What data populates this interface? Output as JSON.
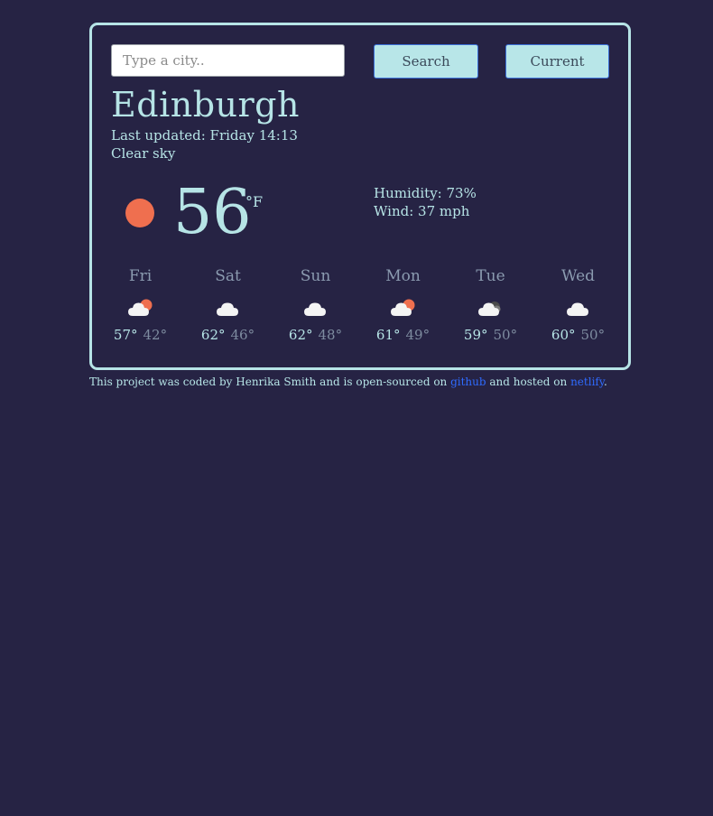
{
  "search": {
    "placeholder": "Type a city..",
    "search_label": "Search",
    "current_label": "Current"
  },
  "weather": {
    "city": "Edinburgh",
    "last_updated": "Last updated: Friday 14:13",
    "description": "Clear sky",
    "temperature": "56",
    "unit": "°F",
    "humidity": "Humidity: 73%",
    "wind": "Wind: 37 mph",
    "icon": "sun-icon"
  },
  "forecast": [
    {
      "day": "Fri",
      "max": "57°",
      "min": "42°",
      "icon": "cloud-sun-icon"
    },
    {
      "day": "Sat",
      "max": "62°",
      "min": "46°",
      "icon": "cloud-icon"
    },
    {
      "day": "Sun",
      "max": "62°",
      "min": "48°",
      "icon": "cloud-icon"
    },
    {
      "day": "Mon",
      "max": "61°",
      "min": "49°",
      "icon": "cloud-sun-icon"
    },
    {
      "day": "Tue",
      "max": "59°",
      "min": "50°",
      "icon": "cloud-moon-icon"
    },
    {
      "day": "Wed",
      "max": "60°",
      "min": "50°",
      "icon": "cloud-icon"
    }
  ],
  "footer": {
    "text_1": "This project was coded by Henrika Smith and is open-sourced on ",
    "github_label": "github",
    "text_2": " and hosted on ",
    "netlify_label": "netlify",
    "text_3": "."
  },
  "colors": {
    "background": "#262344",
    "accent": "#b6e4e6",
    "sun": "#ef6f4f",
    "link": "#2f6bff"
  }
}
